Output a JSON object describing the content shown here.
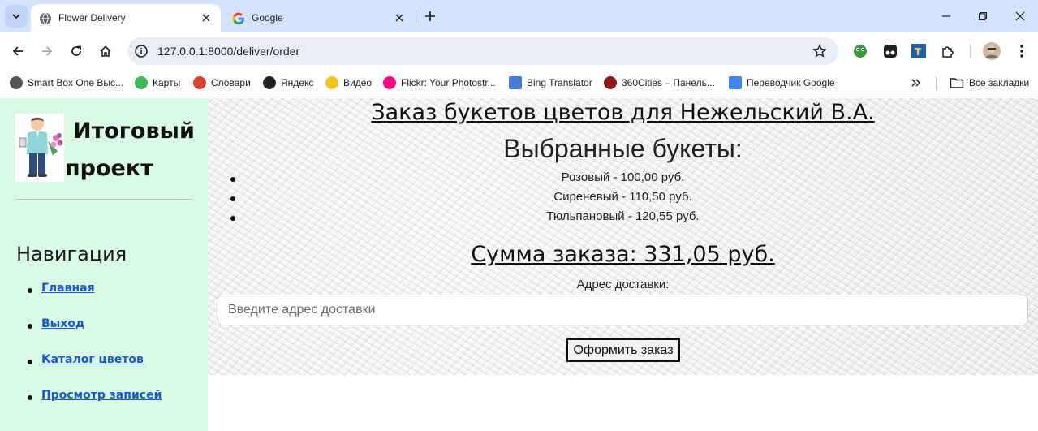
{
  "browser": {
    "tabs": [
      {
        "title": "Flower Delivery",
        "active": true
      },
      {
        "title": "Google",
        "active": false
      }
    ],
    "url": "127.0.0.1:8000/deliver/order",
    "bookmarks": [
      {
        "label": "Smart Box One Выс...",
        "icon": "smartbox-icon",
        "color": "#555555"
      },
      {
        "label": "Карты",
        "icon": "maps-icon",
        "color": "#3cba54"
      },
      {
        "label": "Словари",
        "icon": "dictionary-icon",
        "color": "#d9442b"
      },
      {
        "label": "Яндекс",
        "icon": "yandex-icon",
        "color": "#222222"
      },
      {
        "label": "Видео",
        "icon": "video-icon",
        "color": "#f5c518"
      },
      {
        "label": "Flickr: Your Photostr...",
        "icon": "flickr-icon",
        "color": "#ff0084"
      },
      {
        "label": "Bing Translator",
        "icon": "bing-icon",
        "color": "#4a7bd9"
      },
      {
        "label": "360Cities – Панель...",
        "icon": "360cities-icon",
        "color": "#8b1a1a"
      },
      {
        "label": "Переводчик Google",
        "icon": "google-translate-icon",
        "color": "#4285f4"
      }
    ],
    "all_bookmarks": "Все закладки"
  },
  "sidebar": {
    "title_line1": "Итоговый",
    "title_line2": "проект",
    "nav_heading": "Навигация",
    "nav_items": [
      {
        "label": "Главная"
      },
      {
        "label": "Выход"
      },
      {
        "label": "Каталог цветов"
      },
      {
        "label": "Просмотр записей"
      }
    ]
  },
  "order": {
    "title": "Заказ букетов цветов для Нежельский В.А.",
    "chosen_heading": "Выбранные букеты:",
    "bouquets": [
      "Розовый - 100,00 руб.",
      "Сиреневый - 110,50 руб.",
      "Тюльпановый - 120,55 руб."
    ],
    "total": "Сумма заказа: 331,05 руб.",
    "address_label": "Адрес доставки:",
    "address_placeholder": "Введите адрес доставки",
    "address_value": "",
    "submit_label": "Оформить заказ"
  },
  "colors": {
    "sidebar_bg": "#d9fbe3",
    "link": "#1a56db",
    "tabstrip": "#d3e3fd"
  }
}
